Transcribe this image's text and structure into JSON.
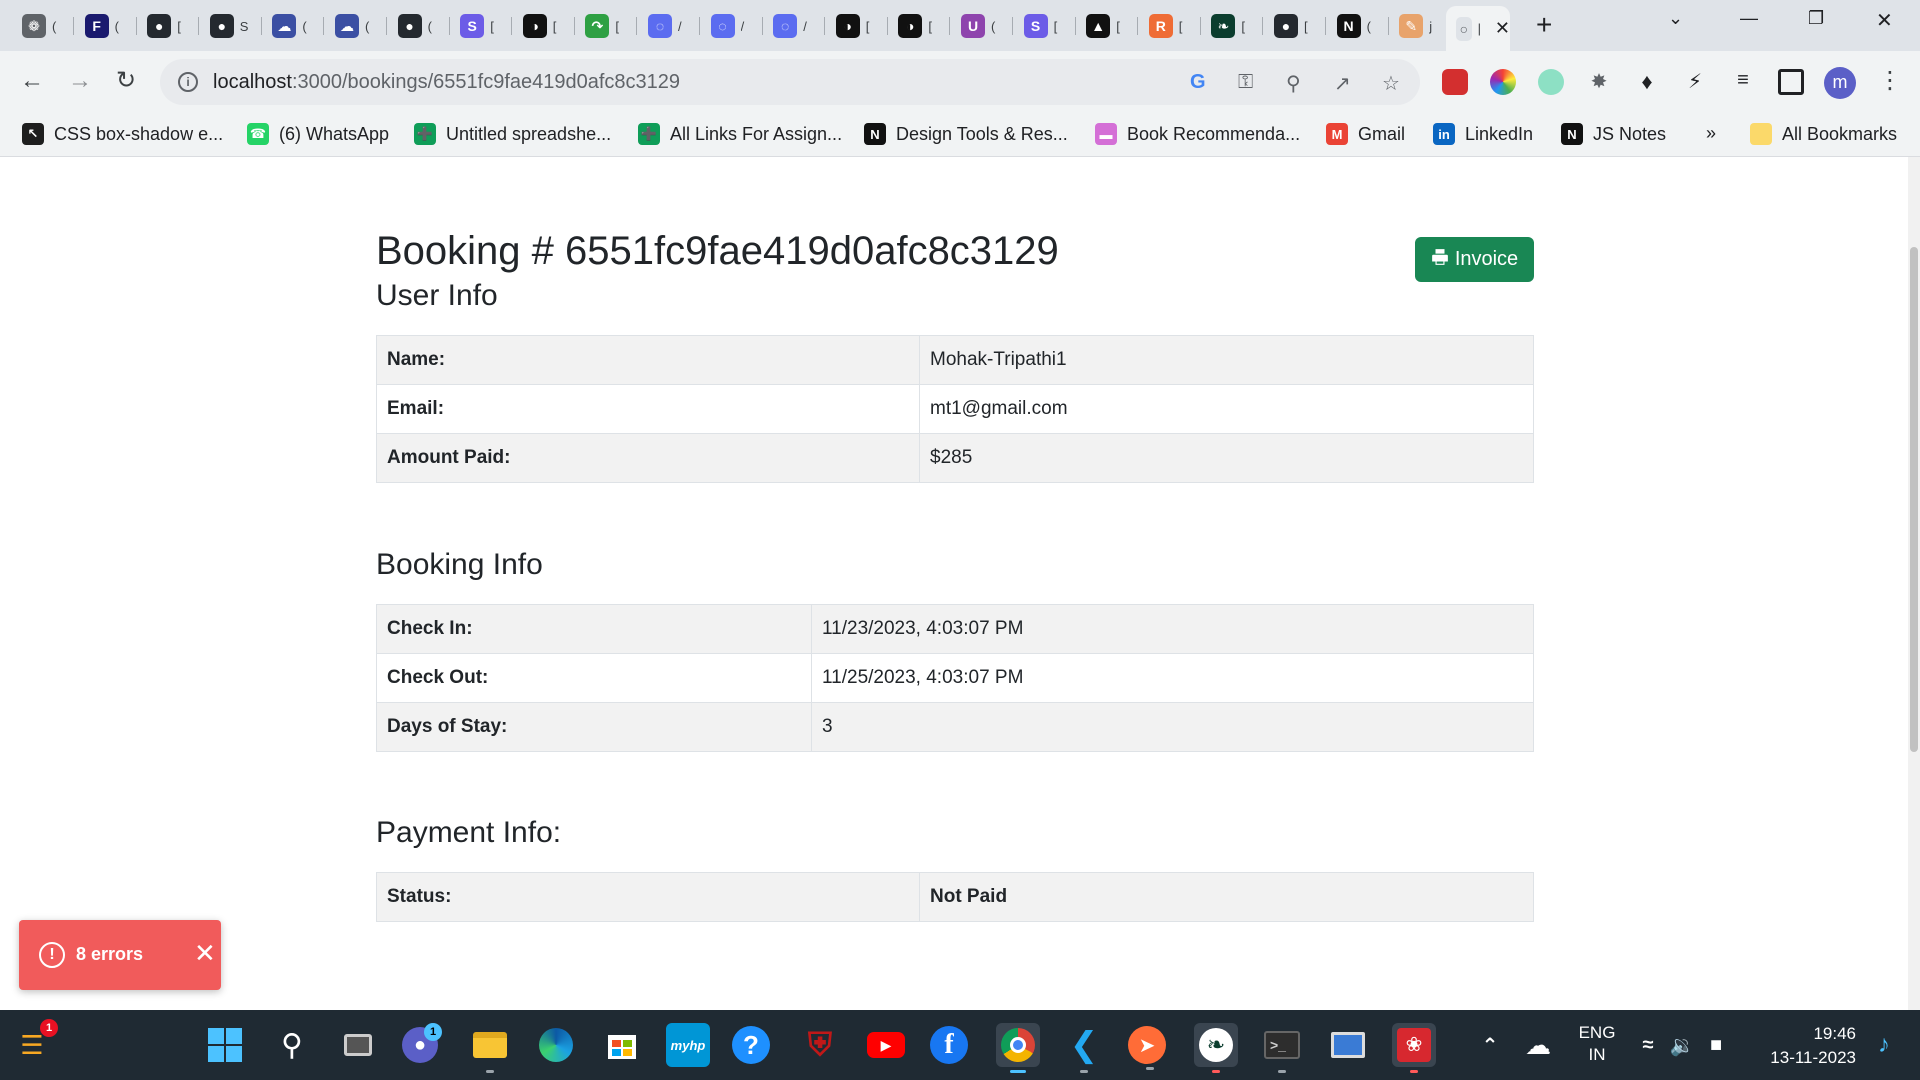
{
  "browser": {
    "tabs": [
      {
        "icon": "chatgpt-icon",
        "color": "#5f6368",
        "glyph": "❁",
        "label": "("
      },
      {
        "icon": "f-icon",
        "color": "#1a1a6e",
        "glyph": "F",
        "label": "("
      },
      {
        "icon": "github-icon",
        "color": "#24292f",
        "glyph": "●",
        "label": "["
      },
      {
        "icon": "github-icon",
        "color": "#24292f",
        "glyph": "●",
        "label": "S"
      },
      {
        "icon": "cloud-icon",
        "color": "#3b4fa3",
        "glyph": "☁",
        "label": "("
      },
      {
        "icon": "cloud-icon",
        "color": "#3b4fa3",
        "glyph": "☁",
        "label": "("
      },
      {
        "icon": "github-icon",
        "color": "#24292f",
        "glyph": "●",
        "label": "("
      },
      {
        "icon": "s-icon",
        "color": "#6c5ce7",
        "glyph": "S",
        "label": "["
      },
      {
        "icon": "pencil-icon",
        "color": "#111111",
        "glyph": "◑",
        "label": "["
      },
      {
        "icon": "share-icon",
        "color": "#2ea043",
        "glyph": "↷",
        "label": "["
      },
      {
        "icon": "chat-icon",
        "color": "#5b6cf0",
        "glyph": "◌",
        "label": "/"
      },
      {
        "icon": "chat-icon",
        "color": "#5b6cf0",
        "glyph": "◌",
        "label": "/"
      },
      {
        "icon": "chat-icon",
        "color": "#5b6cf0",
        "glyph": "◌",
        "label": "/"
      },
      {
        "icon": "pencil-icon",
        "color": "#111111",
        "glyph": "◑",
        "label": "["
      },
      {
        "icon": "pencil-icon",
        "color": "#111111",
        "glyph": "◑",
        "label": "["
      },
      {
        "icon": "u-icon",
        "color": "#8e44ad",
        "glyph": "U",
        "label": "("
      },
      {
        "icon": "s-icon",
        "color": "#6c5ce7",
        "glyph": "S",
        "label": "["
      },
      {
        "icon": "triangle-icon",
        "color": "#111111",
        "glyph": "▲",
        "label": "["
      },
      {
        "icon": "r-icon",
        "color": "#ef6c35",
        "glyph": "R",
        "label": "["
      },
      {
        "icon": "leaf-icon",
        "color": "#0b3d2e",
        "glyph": "❧",
        "label": "["
      },
      {
        "icon": "github-icon",
        "color": "#24292f",
        "glyph": "●",
        "label": "["
      },
      {
        "icon": "notion-icon",
        "color": "#111111",
        "glyph": "N",
        "label": "("
      },
      {
        "icon": "pen-icon",
        "color": "#e8a36b",
        "glyph": "✎",
        "label": "j"
      }
    ],
    "new_tab_label": "+",
    "url_host": "localhost",
    "url_path": ":3000/bookings/6551fc9fae419d0afc8c3129",
    "profile_initial": "m"
  },
  "bookmarks": [
    {
      "label": "CSS box-shadow e...",
      "icon": "cursor-icon",
      "color": "#1e1e1e",
      "glyph": "↖"
    },
    {
      "label": "(6) WhatsApp",
      "icon": "whatsapp-icon",
      "color": "#25d366",
      "glyph": "☎"
    },
    {
      "label": "Untitled spreadshe...",
      "icon": "sheets-icon",
      "color": "#0f9d58",
      "glyph": "➕"
    },
    {
      "label": "All Links For Assign...",
      "icon": "sheets-icon",
      "color": "#0f9d58",
      "glyph": "➕"
    },
    {
      "label": "Design Tools & Res...",
      "icon": "notion-icon",
      "color": "#111111",
      "glyph": "N"
    },
    {
      "label": "Book Recommenda...",
      "icon": "gradient-icon",
      "color": "#d46fd6",
      "glyph": "▬"
    },
    {
      "label": "Gmail",
      "icon": "gmail-icon",
      "color": "#ea4335",
      "glyph": "M"
    },
    {
      "label": "LinkedIn",
      "icon": "linkedin-icon",
      "color": "#0a66c2",
      "glyph": "in"
    },
    {
      "label": "JS Notes",
      "icon": "notion-icon",
      "color": "#111111",
      "glyph": "N"
    }
  ],
  "bookmarks_overflow": "»",
  "all_bookmarks": "All Bookmarks",
  "booking": {
    "title": "Booking # 6551fc9fae419d0afc8c3129",
    "invoice_label": "Invoice",
    "user_info_title": "User Info",
    "user_info": [
      {
        "key": "Name:",
        "value": "Mohak-Tripathi1"
      },
      {
        "key": "Email:",
        "value": "mt1@gmail.com"
      },
      {
        "key": "Amount Paid:",
        "value": "$285"
      }
    ],
    "booking_info_title": "Booking Info",
    "booking_info": [
      {
        "key": "Check In:",
        "value": "11/23/2023, 4:03:07 PM"
      },
      {
        "key": "Check Out:",
        "value": "11/25/2023, 4:03:07 PM"
      },
      {
        "key": "Days of Stay:",
        "value": "3"
      }
    ],
    "payment_info_title": "Payment Info:",
    "payment_info": [
      {
        "key": "Status:",
        "value": "Not Paid"
      }
    ]
  },
  "toast": {
    "text": "8 errors",
    "icon_glyph": "!",
    "close_glyph": "✕"
  },
  "taskbar": {
    "lang_primary": "ENG",
    "lang_secondary": "IN",
    "time": "19:46",
    "date": "13-11-2023",
    "widgets_badge": "1",
    "teams_badge": "1"
  },
  "colors": {
    "invoice": "#198754",
    "not_paid": "#dc3545",
    "toast": "#f15b5b"
  }
}
